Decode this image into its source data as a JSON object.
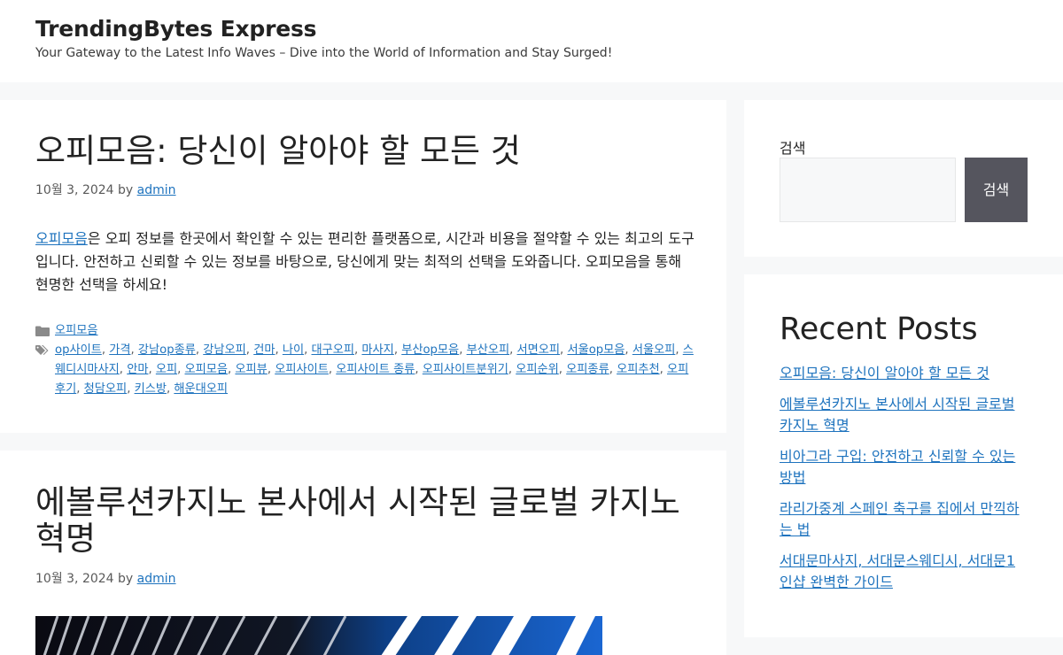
{
  "site": {
    "title": "TrendingBytes Express",
    "description": "Your Gateway to the Latest Info Waves – Dive into the World of Information and Stay Surged!"
  },
  "posts": [
    {
      "title": "오피모음: 당신이 알아야 할 모든 것",
      "date": "10월 3, 2024",
      "by": "by",
      "author": "admin",
      "summary_link": "오피모음",
      "summary_rest": "은 오피 정보를 한곳에서 확인할 수 있는 편리한 플랫폼으로, 시간과 비용을 절약할 수 있는 최고의 도구입니다. 안전하고 신뢰할 수 있는 정보를 바탕으로, 당신에게 맞는 최적의 선택을 도와줍니다. 오피모음을 통해 현명한 선택을 하세요!",
      "category": "오피모음",
      "tags": [
        "op사이트",
        "가격",
        "강남op종류",
        "강남오피",
        "건마",
        "나이",
        "대구오피",
        "마사지",
        "부산op모음",
        "부산오피",
        "서면오피",
        "서울op모음",
        "서울오피",
        "스웨디시마사지",
        "안마",
        "오피",
        "오피모음",
        "오피뷰",
        "오피사이트",
        "오피사이트 종류",
        "오피사이트분위기",
        "오피순위",
        "오피종류",
        "오피추천",
        "오피후기",
        "청담오피",
        "키스방",
        "해운대오피"
      ]
    },
    {
      "title": "에볼루션카지노 본사에서 시작된 글로벌 카지노 혁명",
      "date": "10월 3, 2024",
      "by": "by",
      "author": "admin"
    }
  ],
  "search": {
    "label": "검색",
    "placeholder": "",
    "button": "검색"
  },
  "recent": {
    "title": "Recent Posts",
    "items": [
      "오피모음: 당신이 알아야 할 모든 것",
      "에볼루션카지노 본사에서 시작된 글로벌 카지노 혁명",
      "비아그라 구입: 안전하고 신뢰할 수 있는 방법",
      "라리가중계 스페인 축구를 집에서 만끽하는 법",
      "서대문마사지, 서대문스웨디시, 서대문1인샵 완벽한 가이드"
    ]
  },
  "colors": {
    "link": "#1e73be",
    "button": "#55555e",
    "page_bg": "#f7f8f9"
  },
  "icons": {
    "category": "folder-icon",
    "tags": "tags-icon"
  }
}
